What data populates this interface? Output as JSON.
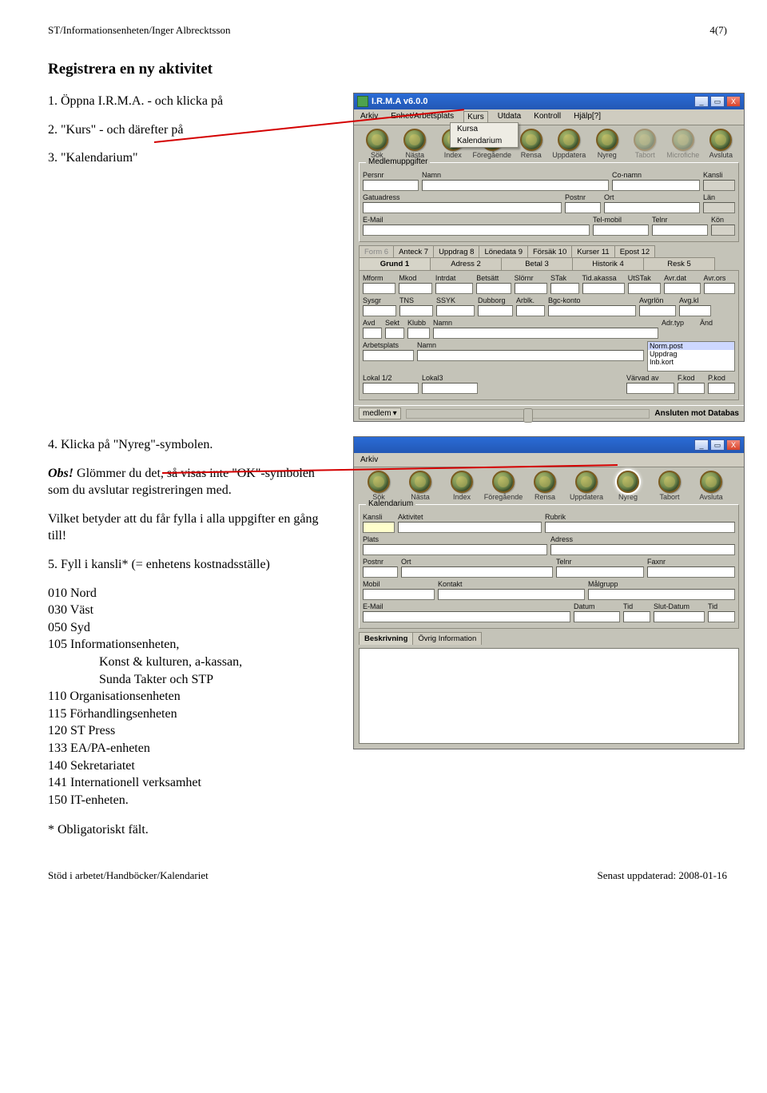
{
  "header": {
    "left": "ST/Informationsenheten/Inger Albrecktsson",
    "right": "4(7)"
  },
  "section_title": "Registrera en ny aktivitet",
  "steps": {
    "s1": "1.  Öppna I.R.M.A. - och klicka på",
    "s2": "2.  \"Kurs\" - och därefter på",
    "s3": "3.  \"Kalendarium\"",
    "s4": "4.  Klicka på \"Nyreg\"-symbolen."
  },
  "obs": {
    "head": "Obs!",
    "body1": " Glömmer du det, så visas inte \"OK\"-symbolen som du avslutar registreringen med.",
    "body2": "Vilket betyder att du får fylla i alla uppgifter en gång till!"
  },
  "kansli": {
    "lead": "5.  Fyll i kansli* (= enhetens kostnadsställe)",
    "rows": [
      "010 Nord",
      "030 Väst",
      "050 Syd",
      "105 Informationsenheten,",
      "Konst & kulturen, a-kassan,",
      "Sunda Takter och STP",
      "110 Organisationsenheten",
      "115 Förhandlingsenheten",
      "120 ST Press",
      "133 EA/PA-enheten",
      "140 Sekretariatet",
      "141 Internationell verksamhet",
      "150 IT-enheten."
    ]
  },
  "oblig": "* Obligatoriskt fält.",
  "footer": {
    "left": "Stöd i arbetet/Handböcker/Kalendariet",
    "right": "Senast uppdaterad: 2008-01-16"
  },
  "win1": {
    "title": "I.R.M.A v6.0.0",
    "menus": [
      "Arkiv",
      "Enhet/Arbetsplats",
      "Kurs",
      "Utdata",
      "Kontroll",
      "Hjälp[?]"
    ],
    "open_menu": [
      "Kursa",
      "Kalendarium"
    ],
    "toolbar": [
      "Sök",
      "Nästa",
      "Index",
      "Föregående",
      "Rensa",
      "Uppdatera",
      "Nyreg",
      "Tabort",
      "Microfiche",
      "Avsluta"
    ],
    "group_leg": "Medlemuppgifter",
    "f": {
      "persnr": "Persnr",
      "namn": "Namn",
      "conamn": "Co-namn",
      "kansli": "Kansli",
      "gatu": "Gatuadress",
      "postnr": "Postnr",
      "ort": "Ort",
      "lan": "Län",
      "email": "E-Mail",
      "telmobil": "Tel-mobil",
      "telnr": "Telnr",
      "kon": "Kön"
    },
    "tabs_top": [
      "Form 6",
      "Anteck 7",
      "Uppdrag 8",
      "Lönedata 9",
      "Försäk 10",
      "Kurser 11",
      "Epost 12"
    ],
    "tabs_bot": [
      "Grund 1",
      "Adress 2",
      "Betal 3",
      "Historik 4",
      "Resk 5"
    ],
    "g": {
      "r1": [
        "Mform",
        "Mkod",
        "Intrdat",
        "Betsätt",
        "Slörnr",
        "STak",
        "Tid.akassa",
        "UtSTak",
        "Avr.dat",
        "Avr.ors"
      ],
      "r2": [
        "Sysgr",
        "TNS",
        "SSYK",
        "Dubborg",
        "Arblk.",
        "Bgc-konto",
        "",
        "",
        "Avgrlön",
        "Avg.kl"
      ],
      "r3": [
        "Avd",
        "Sekt",
        "Klubb",
        "Namn"
      ],
      "r4": [
        "Arbetsplats",
        "Namn"
      ],
      "r5": [
        "Lokal 1/2",
        "Lokal3"
      ],
      "adr": "Adr.typ",
      "and": "Änd",
      "list": [
        "Norm.post",
        "Uppdrag",
        "Inb.kort"
      ],
      "varv": "Värvad av",
      "fkod": "F.kod",
      "pkod": "P.kod"
    },
    "status_left": "medlem",
    "status_right": "Ansluten mot Databas"
  },
  "win2": {
    "menus": [
      "Arkiv"
    ],
    "toolbar": [
      "Sök",
      "Nästa",
      "Index",
      "Föregående",
      "Rensa",
      "Uppdatera",
      "Nyreg",
      "Tabort",
      "Avsluta"
    ],
    "group_leg": "Kalendarium",
    "f": {
      "kansli": "Kansli",
      "aktivitet": "Aktivitet",
      "rubrik": "Rubrik",
      "plats": "Plats",
      "adress": "Adress",
      "postnr": "Postnr",
      "ort": "Ort",
      "telnr": "Telnr",
      "faxnr": "Faxnr",
      "mobil": "Mobil",
      "kontakt": "Kontakt",
      "malgrupp": "Målgrupp",
      "email": "E-Mail",
      "datum": "Datum",
      "tid": "Tid",
      "slutdatum": "Slut-Datum",
      "tid2": "Tid"
    },
    "tabs": [
      "Beskrivning",
      "Övrig Information"
    ]
  }
}
